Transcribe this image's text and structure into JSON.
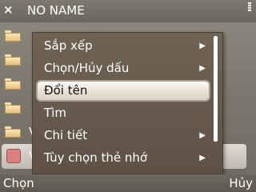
{
  "titlebar": {
    "close_icon": "×",
    "title": "NO NAME"
  },
  "list": {
    "rows": [
      {
        "icon": "folder-icon"
      },
      {
        "icon": "folder-icon"
      },
      {
        "icon": "folder-icon"
      },
      {
        "icon": "folder-icon"
      },
      {
        "icon": "folder-icon",
        "label_visible": "V"
      },
      {
        "icon": "memory-card-icon",
        "label_visible": "V"
      }
    ]
  },
  "menu": {
    "items": [
      {
        "label": "Sắp xếp",
        "submenu": true
      },
      {
        "label": "Chọn/Hủy dấu",
        "submenu": true
      },
      {
        "label": "Đổi tên",
        "submenu": false,
        "selected": true
      },
      {
        "label": "Tìm",
        "submenu": false
      },
      {
        "label": "Chi tiết",
        "submenu": true
      },
      {
        "label": "Tùy chọn thẻ nhớ",
        "submenu": true
      }
    ],
    "arrow_glyph": "▶"
  },
  "softkeys": {
    "left": "Chọn",
    "right": "Hủy"
  },
  "colors": {
    "menu_bg": "#665a4c",
    "selected_bg": "#f2efe6",
    "text": "#ffffff"
  }
}
